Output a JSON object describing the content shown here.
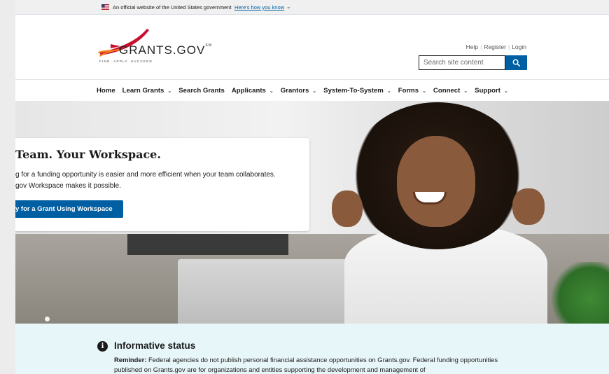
{
  "gov_banner": {
    "text": "An official website of the United States government",
    "link": "Here's how you know"
  },
  "header": {
    "logo_title": "GRANTS.GOV",
    "logo_tm": "SM",
    "logo_tagline": "FIND. APPLY. SUCCEED.",
    "util_links": [
      "Help",
      "Register",
      "Login"
    ],
    "search": {
      "placeholder": "Search site content",
      "button_icon": "search-icon"
    }
  },
  "nav": {
    "items": [
      {
        "label": "Home",
        "dropdown": false
      },
      {
        "label": "Learn Grants",
        "dropdown": true
      },
      {
        "label": "Search Grants",
        "dropdown": false
      },
      {
        "label": "Applicants",
        "dropdown": true
      },
      {
        "label": "Grantors",
        "dropdown": true
      },
      {
        "label": "System-To-System",
        "dropdown": true
      },
      {
        "label": "Forms",
        "dropdown": true
      },
      {
        "label": "Connect",
        "dropdown": true
      },
      {
        "label": "Support",
        "dropdown": true
      }
    ]
  },
  "hero": {
    "heading": "Team. Your Workspace.",
    "line1": "g for a funding opportunity is easier and more efficient when your team collaborates.",
    "line2": "gov Workspace makes it possible.",
    "cta": "y for a Grant Using Workspace"
  },
  "status": {
    "icon": "info-icon",
    "title": "Informative status",
    "reminder_label": "Reminder:",
    "message": " Federal agencies do not publish personal financial assistance opportunities on Grants.gov. Federal funding opportunities published on Grants.gov are for organizations and entities supporting the development and management of"
  },
  "colors": {
    "primary": "#005ea2",
    "status_bg": "#e7f6f8",
    "logo_red": "#c8102e",
    "logo_orange": "#f58220"
  }
}
